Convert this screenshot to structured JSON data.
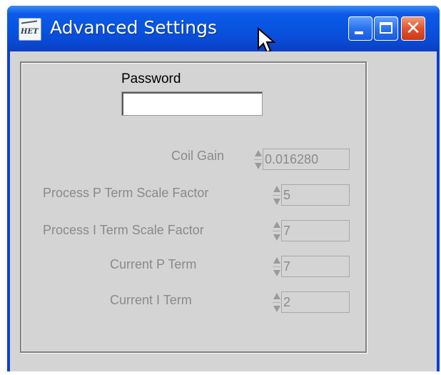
{
  "window": {
    "title": "Advanced Settings",
    "app_icon_text": "HET",
    "controls": [
      "minimize",
      "maximize",
      "close"
    ],
    "close_glyph": "✕"
  },
  "password": {
    "label": "Password",
    "value": ""
  },
  "fields": [
    {
      "label": "Coil  Gain",
      "value": "0.016280"
    },
    {
      "label": "Process P Term Scale Factor",
      "value": "5"
    },
    {
      "label": "Process I Term Scale Factor",
      "value": "7"
    },
    {
      "label": "Current P Term",
      "value": "7"
    },
    {
      "label": "Current I Term",
      "value": "2"
    }
  ],
  "colors": {
    "titlebar": "#0754e0",
    "close_button": "#e2522c",
    "dialog_bg": "#d4d4d4",
    "disabled_text": "#8a8a8a"
  }
}
